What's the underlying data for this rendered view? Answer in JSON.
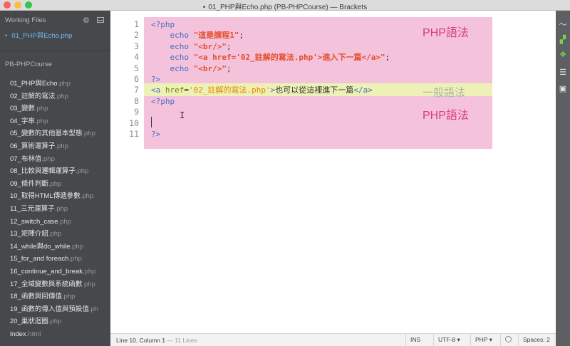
{
  "window": {
    "title": "01_PHP與Echo.php (PB-PHPCourse) — Brackets",
    "modified_marker": "•"
  },
  "sidebar": {
    "working_files_header": "Working Files",
    "working_files": [
      {
        "name": "01_PHP與Echo.php"
      }
    ],
    "project_title": "PB-PHPCourse",
    "files": [
      {
        "base": "01_PHP與Echo",
        "ext": ".php"
      },
      {
        "base": "02_註解的寫法",
        "ext": ".php"
      },
      {
        "base": "03_變數",
        "ext": ".php"
      },
      {
        "base": "04_字串",
        "ext": ".php"
      },
      {
        "base": "05_變數的其他基本型態",
        "ext": ".php"
      },
      {
        "base": "06_算術運算子",
        "ext": ".php"
      },
      {
        "base": "07_布林值",
        "ext": ".php"
      },
      {
        "base": "08_比較與邏輯運算子",
        "ext": ".php"
      },
      {
        "base": "09_條件判斷",
        "ext": ".php"
      },
      {
        "base": "10_取得HTML傳遞參數",
        "ext": ".php"
      },
      {
        "base": "11_三元運算子",
        "ext": ".php"
      },
      {
        "base": "12_switch_case",
        "ext": ".php"
      },
      {
        "base": "13_矩陣介紹",
        "ext": ".php"
      },
      {
        "base": "14_while與do_while",
        "ext": ".php"
      },
      {
        "base": "15_for_and foreach",
        "ext": ".php"
      },
      {
        "base": "16_continue_and_break",
        "ext": ".php"
      },
      {
        "base": "17_全域變數與系統函數",
        "ext": ".php"
      },
      {
        "base": "18_函數與回傳值",
        "ext": ".php"
      },
      {
        "base": "19_函數的傳入值與預設值",
        "ext": ".ph"
      },
      {
        "base": "20_巢狀迴圈",
        "ext": ".php"
      },
      {
        "base": "index",
        "ext": ".html"
      }
    ]
  },
  "editor": {
    "line_numbers": [
      "1",
      "2",
      "3",
      "4",
      "5",
      "6",
      "7",
      "8",
      "9",
      "10",
      "11"
    ],
    "lines": {
      "l1": "<?php",
      "l2_kw": "echo",
      "l2_str": "\"這是課程1\"",
      "l2_end": ";",
      "l3_kw": "echo",
      "l3_str": "\"<br/>\"",
      "l3_end": ";",
      "l4_kw": "echo",
      "l4_str": "\"<a href='02_註解的寫法.php'>進入下一篇</a>\"",
      "l4_end": ";",
      "l5_kw": "echo",
      "l5_str": "\"<br/>\"",
      "l5_end": ";",
      "l6": "?>",
      "l7_tag_open": "<a",
      "l7_attr": "href",
      "l7_eq": "=",
      "l7_val": "'02_註解的寫法.php'",
      "l7_gt": ">",
      "l7_text": "也可以從這裡進下一篇",
      "l7_tag_close": "</a>",
      "l8": "<?php",
      "l9": "",
      "l10": "",
      "l11": "?>"
    },
    "annotations": {
      "php_top": "PHP語法",
      "normal": "一般語法",
      "php_bottom": "PHP語法"
    },
    "colors": {
      "php_block": "#f5c2dc",
      "html_block": "#eef1b6",
      "php_label": "#d83a7e"
    }
  },
  "statusbar": {
    "position": "Line 10, Column 1",
    "lines_count": "— 11 Lines",
    "mode": "INS",
    "encoding": "UTF-8 ▾",
    "language": "PHP ▾",
    "spaces": "Spaces: 2"
  },
  "toolbar_icons": [
    "live-preview-icon",
    "extension-manager-icon",
    "extension-icon",
    "file-list-icon",
    "image-icon"
  ]
}
